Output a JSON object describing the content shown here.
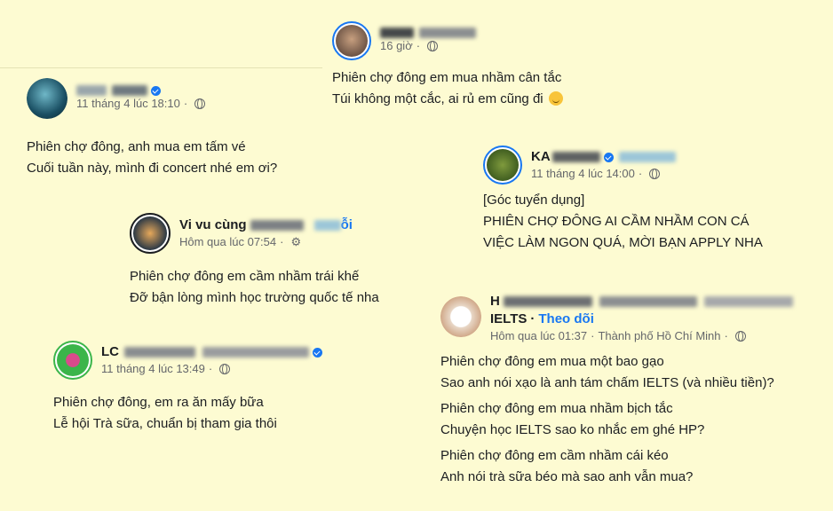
{
  "colors": {
    "background": "#fdfbd2",
    "link": "#1877f2",
    "meta": "#65676b"
  },
  "posts": [
    {
      "name_visible": "",
      "time": "11 tháng 4 lúc 18:10",
      "lines": [
        "Phiên chợ đông, anh mua em tấm vé",
        "Cuối tuần này, mình đi concert nhé em ơi?"
      ]
    },
    {
      "name_visible": "",
      "time": "16 giờ",
      "lines": [
        "Phiên chợ đông em mua nhầm cân tắc",
        "Túi không một cắc, ai rủ em cũng đi"
      ]
    },
    {
      "name_visible": "KA",
      "time": "11 tháng 4 lúc 14:00",
      "lines": [
        "[Góc tuyển dụng]",
        "PHIÊN CHỢ ĐÔNG AI CẦM NHẦM CON CÁ",
        "VIỆC LÀM NGON QUÁ, MỜI BẠN APPLY NHA"
      ]
    },
    {
      "name_visible": "Vi vu cùng",
      "name_suffix": "ỗi",
      "time": "Hôm qua lúc 07:54",
      "lines": [
        "Phiên chợ đông em cầm nhầm trái khế",
        "Đỡ bận lòng mình học trường quốc tế nha"
      ]
    },
    {
      "name_visible": "LC",
      "time": "11 tháng 4 lúc 13:49",
      "lines": [
        "Phiên chợ đông, em ra ăn mấy bữa",
        "Lễ hội Trà sữa, chuẩn bị tham gia thôi"
      ]
    },
    {
      "name_visible": "H",
      "name_line2": "IELTS",
      "follow": "Theo dõi",
      "time": "Hôm qua lúc 01:37",
      "location": "Thành phố Hồ Chí Minh",
      "lines": [
        "Phiên chợ đông em mua một bao gạo",
        "Sao anh nói xạo là anh tám chấm IELTS (và nhiều tiền)?",
        "Phiên chợ đông em mua nhầm bịch tắc",
        "Chuyện học IELTS sao ko nhắc em ghé HP?",
        "Phiên chợ đông em cầm nhầm cái kéo",
        "Anh nói trà sữa béo mà sao anh vẫn mua?"
      ]
    }
  ]
}
